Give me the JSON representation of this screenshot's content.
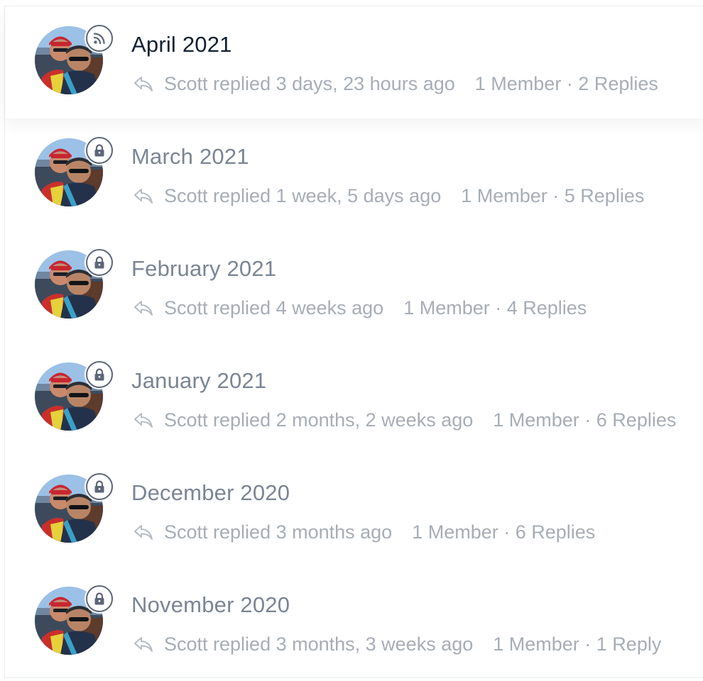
{
  "colors": {
    "title_active": "#122032",
    "title_inactive": "#7a8594",
    "meta_text": "#a7adb6",
    "badge_border": "#5b6677"
  },
  "topics": [
    {
      "title": "April 2021",
      "status_icon": "rss-icon",
      "active": true,
      "freshness": "Scott replied 3 days, 23 hours ago",
      "counts": "1 Member · 2 Replies"
    },
    {
      "title": "March 2021",
      "status_icon": "lock-icon",
      "active": false,
      "freshness": "Scott replied 1 week, 5 days ago",
      "counts": "1 Member · 5 Replies"
    },
    {
      "title": "February 2021",
      "status_icon": "lock-icon",
      "active": false,
      "freshness": "Scott replied 4 weeks ago",
      "counts": "1 Member · 4 Replies"
    },
    {
      "title": "January 2021",
      "status_icon": "lock-icon",
      "active": false,
      "freshness": "Scott replied 2 months, 2 weeks ago",
      "counts": "1 Member · 6 Replies"
    },
    {
      "title": "December 2020",
      "status_icon": "lock-icon",
      "active": false,
      "freshness": "Scott replied 3 months ago",
      "counts": "1 Member · 6 Replies"
    },
    {
      "title": "November 2020",
      "status_icon": "lock-icon",
      "active": false,
      "freshness": "Scott replied 3 months, 3 weeks ago",
      "counts": "1 Member · 1 Reply"
    }
  ]
}
